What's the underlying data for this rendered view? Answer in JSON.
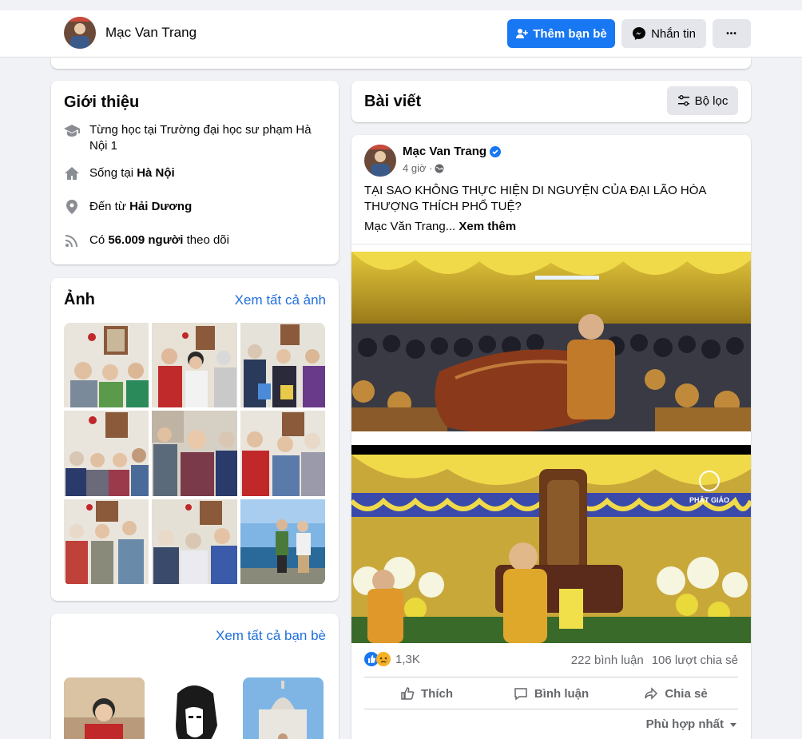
{
  "header": {
    "name": "Mạc Van Trang",
    "add_friend": "Thêm bạn bè",
    "message": "Nhắn tin",
    "more": "•••"
  },
  "intro": {
    "title": "Giới thiệu",
    "studied": "Từng học tại Trường đại học sư phạm Hà Nội 1",
    "lives_prefix": "Sống tại ",
    "lives_place": "Hà Nội",
    "from_prefix": "Đến từ ",
    "from_place": "Hải Dương",
    "followers_prefix": "Có ",
    "followers_count": "56.009 người",
    "followers_suffix": " theo dõi"
  },
  "photos": {
    "title": "Ảnh",
    "see_all": "Xem tất cả ảnh"
  },
  "friends": {
    "see_all": "Xem tất cả bạn bè"
  },
  "posts": {
    "title": "Bài viết",
    "filter": "Bộ lọc"
  },
  "post": {
    "author": "Mạc Van Trang",
    "time": "4 giờ ·",
    "text": "TẠI SAO KHÔNG THỰC HIỆN DI NGUYỆN CỦA ĐẠI LÃO HÒA THƯỢNG THÍCH PHỔ TUỆ?",
    "author_line": "Mạc Văn Trang...",
    "see_more": "Xem thêm",
    "image2_watermark": "PHẬT GIÁO",
    "reactions_count": "1,3K",
    "comments": "222 bình luận",
    "shares": "106 lượt chia sẻ",
    "like": "Thích",
    "comment": "Bình luận",
    "share": "Chia sẻ",
    "sort": "Phù hợp nhất"
  },
  "colors": {
    "accent": "#1877f2",
    "link": "#216fdb",
    "background": "#f0f2f5"
  }
}
